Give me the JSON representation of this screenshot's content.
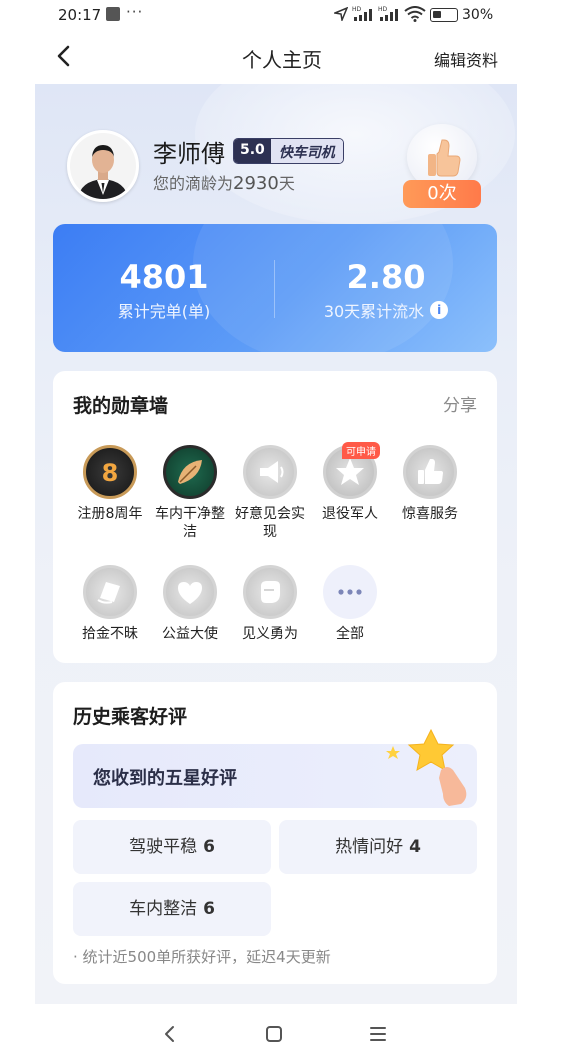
{
  "status_bar": {
    "time": "20:17",
    "dots": "···",
    "battery_percent": "30%"
  },
  "header": {
    "title": "个人主页",
    "edit_label": "编辑资料"
  },
  "profile": {
    "name": "李师傅",
    "rating": "5.0",
    "driver_type": "快车司机",
    "tenure_prefix": "您的滴龄为",
    "tenure_days": "2930",
    "tenure_suffix": "天",
    "likes": "0次"
  },
  "stats": {
    "completed_orders": {
      "value": "4801",
      "label": "累计完单(单)"
    },
    "flow_30d": {
      "value": "2.80",
      "label": "30天累计流水"
    }
  },
  "medal_wall": {
    "title": "我的勋章墙",
    "share_label": "分享",
    "apply_tag": "可申请",
    "medals": [
      {
        "label": "注册8周年",
        "icon": "badge-8-years-icon"
      },
      {
        "label": "车内干净整洁",
        "icon": "leaf-badge-icon"
      },
      {
        "label": "好意见会实现",
        "icon": "megaphone-badge-icon"
      },
      {
        "label": "退役军人",
        "icon": "star-badge-icon"
      },
      {
        "label": "惊喜服务",
        "icon": "thumbs-up-badge-icon"
      },
      {
        "label": "拾金不昧",
        "icon": "wallet-badge-icon"
      },
      {
        "label": "公益大使",
        "icon": "heart-badge-icon"
      },
      {
        "label": "见义勇为",
        "icon": "fist-badge-icon"
      },
      {
        "label": "全部",
        "icon": "more-icon"
      }
    ]
  },
  "reviews": {
    "title": "历史乘客好评",
    "five_star_label": "您收到的五星好评",
    "tags": [
      {
        "label": "驾驶平稳",
        "count": "6"
      },
      {
        "label": "热情问好",
        "count": "4"
      },
      {
        "label": "车内整洁",
        "count": "6"
      }
    ],
    "footnote": "· 统计近500单所获好评，延迟4天更新"
  },
  "colors": {
    "stats_card_start": "#3c7df4",
    "stats_card_end": "#8cc0fb",
    "likes_badge": "#ff8a50",
    "apply_tag": "#ff5a48"
  }
}
